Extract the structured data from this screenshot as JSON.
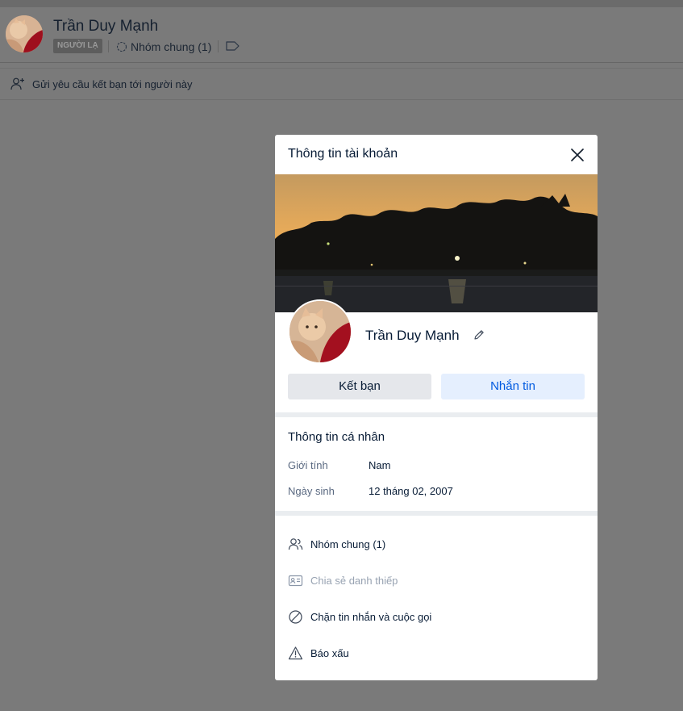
{
  "chat_header": {
    "name": "Trần Duy Mạnh",
    "stranger_badge": "NGƯỜI LẠ",
    "group_link": "Nhóm chung (1)"
  },
  "friend_request_bar": {
    "label": "Gửi yêu cầu kết bạn tới người này"
  },
  "modal": {
    "title": "Thông tin tài khoản",
    "profile_name": "Trần Duy Mạnh",
    "add_friend_label": "Kết bạn",
    "message_label": "Nhắn tin",
    "personal_info": {
      "title": "Thông tin cá nhân",
      "gender_label": "Giới tính",
      "gender_value": "Nam",
      "birthday_label": "Ngày sinh",
      "birthday_value": "12 tháng 02, 2007"
    },
    "actions": [
      {
        "label": "Nhóm chung (1)",
        "icon": "group-icon",
        "enabled": true
      },
      {
        "label": "Chia sẻ danh thiếp",
        "icon": "contact-card-icon",
        "enabled": false
      },
      {
        "label": "Chặn tin nhắn và cuộc gọi",
        "icon": "block-icon",
        "enabled": true
      },
      {
        "label": "Báo xấu",
        "icon": "warning-icon",
        "enabled": true
      }
    ]
  },
  "colors": {
    "overlay": "#7a7a7a",
    "primary_blue": "#005ae0",
    "message_button_bg": "#e5effe",
    "secondary_button_bg": "#e5e7eb"
  }
}
